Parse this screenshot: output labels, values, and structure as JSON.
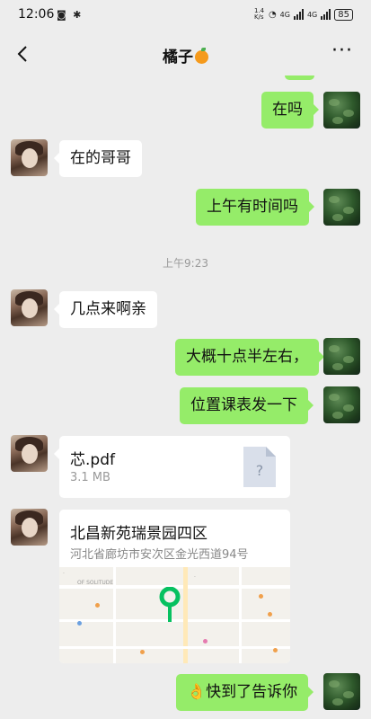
{
  "status": {
    "time": "12:06",
    "net_speed": "1.4 K/s",
    "net_type_1": "4G",
    "net_type_2": "4G",
    "battery": "85"
  },
  "header": {
    "title": "橘子",
    "back_icon": "chevron-left-icon",
    "more_label": "···"
  },
  "messages": {
    "m1": "在吗",
    "m2": "在的哥哥",
    "m3": "上午有时间吗",
    "timestamp": "上午9:23",
    "m4": "几点来啊亲",
    "m5": "大概十点半左右，",
    "m6": "位置课表发一下",
    "file": {
      "name": "芯.pdf",
      "size": "3.1 MB",
      "icon_glyph": "?"
    },
    "location": {
      "title": "北昌新苑瑞景园四区",
      "address": "河北省廊坊市安次区金光西道94号"
    },
    "m7_emoji": "👌",
    "m7": "快到了告诉你"
  },
  "colors": {
    "outgoing_bubble": "#95ec69",
    "incoming_bubble": "#ffffff",
    "background": "#ededed",
    "pin": "#07c160"
  }
}
